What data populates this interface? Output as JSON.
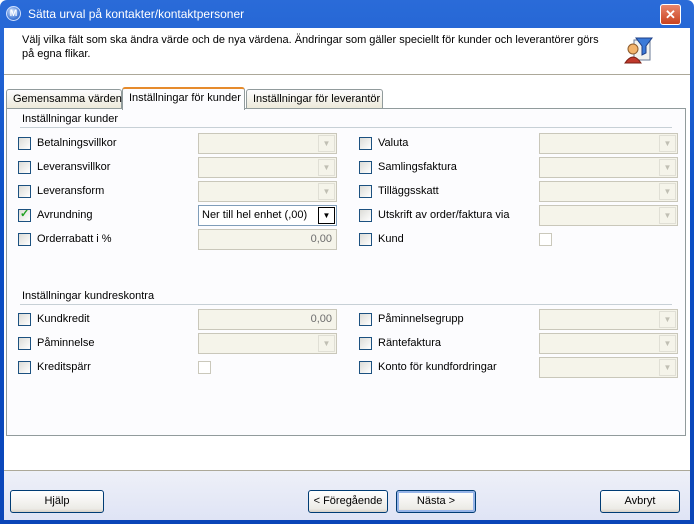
{
  "window": {
    "title": "Sätta urval på kontakter/kontaktpersoner",
    "app_icon_glyph": "M",
    "close_glyph": "✕"
  },
  "header": {
    "description": "Välj vilka fält som ska ändra värde och de nya värdena. Ändringar som gäller speciellt för kunder och leverantörer görs på egna flikar."
  },
  "tabs": [
    {
      "label": "Gemensamma värden",
      "active": false
    },
    {
      "label": "Inställningar för kunder",
      "active": true
    },
    {
      "label": "Inställningar för leverantör",
      "active": false
    }
  ],
  "group_kunder": {
    "title": "Inställningar kunder",
    "left": [
      {
        "label": "Betalningsvillkor",
        "checked": false,
        "control": "combo",
        "value": "",
        "enabled": false
      },
      {
        "label": "Leveransvillkor",
        "checked": false,
        "control": "combo",
        "value": "",
        "enabled": false
      },
      {
        "label": "Leveransform",
        "checked": false,
        "control": "combo",
        "value": "",
        "enabled": false
      },
      {
        "label": "Avrundning",
        "checked": true,
        "control": "combo",
        "value": "Ner till hel enhet (,00)",
        "enabled": true
      },
      {
        "label": "Orderrabatt i %",
        "checked": false,
        "control": "text",
        "value": "0,00",
        "enabled": false
      }
    ],
    "right": [
      {
        "label": "Valuta",
        "checked": false,
        "control": "combo",
        "value": ""
      },
      {
        "label": "Samlingsfaktura",
        "checked": false,
        "control": "combo",
        "value": ""
      },
      {
        "label": "Tilläggsskatt",
        "checked": false,
        "control": "combo",
        "value": ""
      },
      {
        "label": "Utskrift av order/faktura via",
        "checked": false,
        "control": "combo",
        "value": ""
      },
      {
        "label": "Kund",
        "checked": false,
        "control": "checkbox",
        "value": ""
      }
    ]
  },
  "group_kundreskontra": {
    "title": "Inställningar kundreskontra",
    "left": [
      {
        "label": "Kundkredit",
        "checked": false,
        "control": "text",
        "value": "0,00"
      },
      {
        "label": "Påminnelse",
        "checked": false,
        "control": "combo",
        "value": ""
      },
      {
        "label": "Kreditspärr",
        "checked": false,
        "control": "checkbox",
        "value": ""
      }
    ],
    "right": [
      {
        "label": "Påminnelsegrupp",
        "checked": false,
        "control": "combo",
        "value": ""
      },
      {
        "label": "Räntefaktura",
        "checked": false,
        "control": "combo",
        "value": ""
      },
      {
        "label": "Konto för kundfordringar",
        "checked": false,
        "control": "combo",
        "value": ""
      }
    ]
  },
  "footer": {
    "help_label": "Hjälp",
    "prev_label": "< Föregående",
    "next_label": "Nästa >",
    "cancel_label": "Avbryt"
  },
  "icons": {
    "combo_arrow": "▼",
    "check": "✓"
  }
}
